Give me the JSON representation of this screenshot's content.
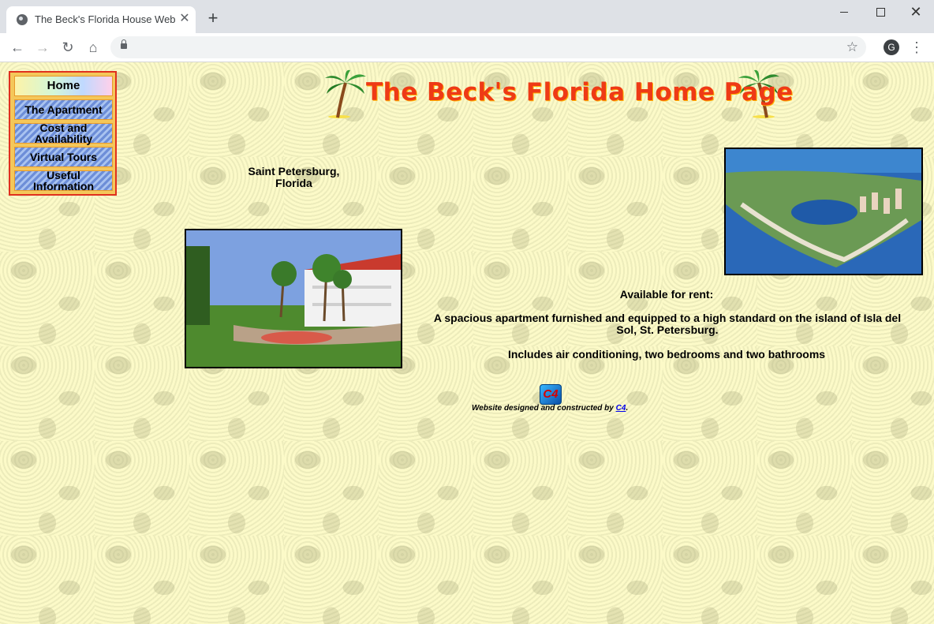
{
  "browser": {
    "tab_title": "The Beck's Florida House Website",
    "tab_close": "✕",
    "new_tab": "+",
    "win_close": "✕",
    "nav_back": "←",
    "nav_forward": "→",
    "nav_reload": "↻",
    "nav_home": "⌂",
    "star": "☆",
    "profile_initial": "G",
    "menu": "⋮"
  },
  "page": {
    "title": "The Beck's Florida Home Page",
    "nav": {
      "home": "Home",
      "apartment": "The Apartment",
      "cost_line1": "Cost and",
      "cost_line2": "Availability",
      "tours": "Virtual Tours",
      "info_line1": "Useful",
      "info_line2": "Information"
    },
    "city_line1": "Saint Petersburg,",
    "city_line2": "Florida",
    "available_title": "Available for rent:",
    "available_desc": "A spacious apartment furnished and equipped to a high standard on the island of Isla del Sol, St. Petersburg.",
    "amenities": "Includes air conditioning, two bedrooms and two bathrooms",
    "c4_logo_text": "C4",
    "credit_text": "Website designed and constructed by ",
    "credit_link": "C4",
    "credit_end": "."
  }
}
